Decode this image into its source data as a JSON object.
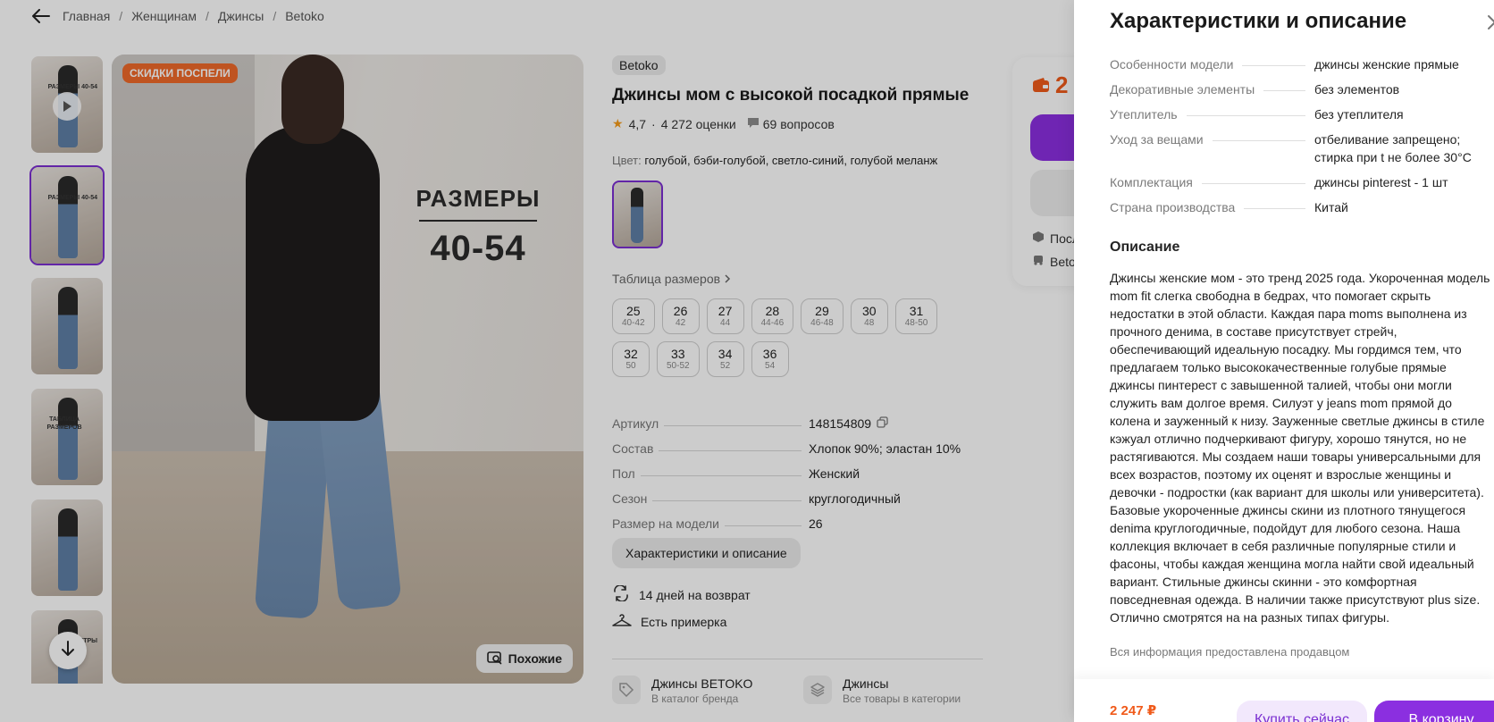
{
  "breadcrumb": {
    "items": [
      "Главная",
      "Женщинам",
      "Джинсы",
      "Betoko"
    ],
    "separator": "/"
  },
  "gallery": {
    "sale_badge": "СКИДКИ ПОСПЕЛИ",
    "main_overlay_title": "РАЗМЕРЫ",
    "main_overlay_range": "40-54",
    "similar_button": "Похожие",
    "thumb_texts": [
      "РАЗМЕРЫ 40-54",
      "РАЗМЕРЫ 40-54",
      "",
      "ТАБЛИЦА РАЗМЕРОВ",
      "",
      "ПАРАМЕТРЫ"
    ],
    "active_thumb": 1
  },
  "product": {
    "brand": "Betoko",
    "title": "Джинсы мом с высокой посадкой прямые",
    "rating": "4,7",
    "reviews": "4 272 оценки",
    "questions": "69 вопросов",
    "color_label": "Цвет:",
    "color_value": "голубой, бэби-голубой, светло-синий, голубой меланж",
    "size_table_link": "Таблица размеров",
    "sizes": [
      {
        "size": "25",
        "range": "40-42"
      },
      {
        "size": "26",
        "range": "42"
      },
      {
        "size": "27",
        "range": "44"
      },
      {
        "size": "28",
        "range": "44-46"
      },
      {
        "size": "29",
        "range": "46-48"
      },
      {
        "size": "30",
        "range": "48"
      },
      {
        "size": "31",
        "range": "48-50"
      },
      {
        "size": "32",
        "range": "50"
      },
      {
        "size": "33",
        "range": "50-52"
      },
      {
        "size": "34",
        "range": "52"
      },
      {
        "size": "36",
        "range": "54"
      }
    ],
    "params": [
      {
        "key": "Артикул",
        "value": "148154809"
      },
      {
        "key": "Состав",
        "value": "Хлопок 90%; эластан 10%"
      },
      {
        "key": "Пол",
        "value": "Женский"
      },
      {
        "key": "Сезон",
        "value": "круглогодичный"
      },
      {
        "key": "Размер на модели",
        "value": "26"
      }
    ],
    "char_button": "Характеристики и описание",
    "return_text": "14 дней на возврат",
    "fitting_text": "Есть примерка",
    "brand_link": {
      "title": "Джинсы BETOKO",
      "subtitle": "В каталог бренда"
    },
    "category_link": {
      "title": "Джинсы",
      "subtitle": "Все товары в категории"
    }
  },
  "buy_card": {
    "price_partial": "2",
    "line1_partial": "Посл",
    "line2_partial": "Beto"
  },
  "panel": {
    "title": "Характеристики и описание",
    "specs": [
      {
        "key": "Особенности модели",
        "value": "джинсы женские прямые"
      },
      {
        "key": "Декоративные элементы",
        "value": "без элементов"
      },
      {
        "key": "Утеплитель",
        "value": "без утеплителя"
      },
      {
        "key": "Уход за вещами",
        "value": "отбеливание запрещено; стирка при t не более 30°C"
      },
      {
        "key": "Комплектация",
        "value": "джинсы pinterest - 1 шт"
      },
      {
        "key": "Страна производства",
        "value": "Китай"
      }
    ],
    "description_title": "Описание",
    "description": "Джинсы женские мом - это тренд 2025 года. Укороченная модель mom fit слегка свободна в бедрах, что помогает скрыть недостатки в этой области. Каждая пара moms выполнена из прочного денима, в составе присутствует стрейч, обеспечивающий идеальную посадку. Мы гордимся тем, что предлагаем только высококачественные голубые прямые джинсы пинтерест с завышенной талией, чтобы они могли служить вам долгое время. Силуэт у jeans mom прямой до колена и зауженный к низу. Зауженные светлые джинсы в стиле кэжуал отлично подчеркивают фигуру, хорошо тянутся, но не растягиваются. Мы создаем наши товары универсальными для всех возрастов, поэтому их оценят и взрослые женщины и девочки - подростки (как вариант для школы или университета). Базовые укороченные джинсы скини из плотного тянущегося denima круглогодичные, подойдут для любого сезона. Наша коллекция включает в себя различные популярные стили и фасоны, чтобы каждая женщина могла найти свой идеальный вариант. Стильные джинсы скинни - это комфортная повседневная одежда. В наличии также присутствуют plus size. Отлично смотрятся на на разных типах фигуры.",
    "seller_note": "Вся информация предоставлена продавцом",
    "bottom_price": "2 247 ₽",
    "buy_now": "Купить сейчас",
    "add_to_cart": "В корзину"
  },
  "colors": {
    "accent": "#8b2fe0",
    "price": "#f05a1a",
    "sale_badge": "#ef6a2a",
    "star": "#f59b19"
  }
}
